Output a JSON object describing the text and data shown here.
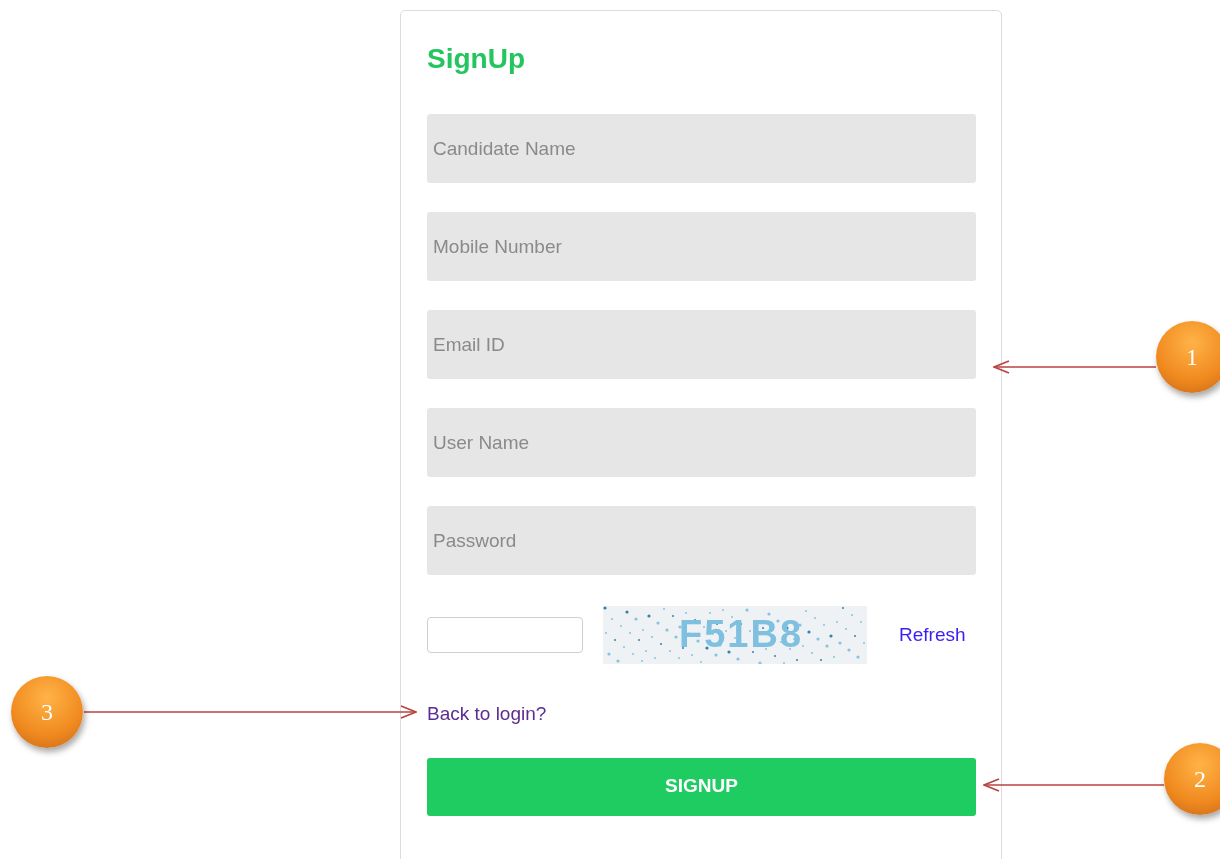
{
  "form": {
    "title": "SignUp",
    "fields": [
      {
        "placeholder": "Candidate Name"
      },
      {
        "placeholder": "Mobile Number"
      },
      {
        "placeholder": "Email ID"
      },
      {
        "placeholder": "User Name"
      },
      {
        "placeholder": "Password"
      }
    ],
    "captcha": {
      "code": "F51B8",
      "refresh": "Refresh"
    },
    "back_link": "Back to login?",
    "submit": "SIGNUP"
  },
  "callouts": [
    {
      "number": "1",
      "kind": "left"
    },
    {
      "number": "2",
      "kind": "left"
    },
    {
      "number": "3",
      "kind": "right"
    }
  ]
}
